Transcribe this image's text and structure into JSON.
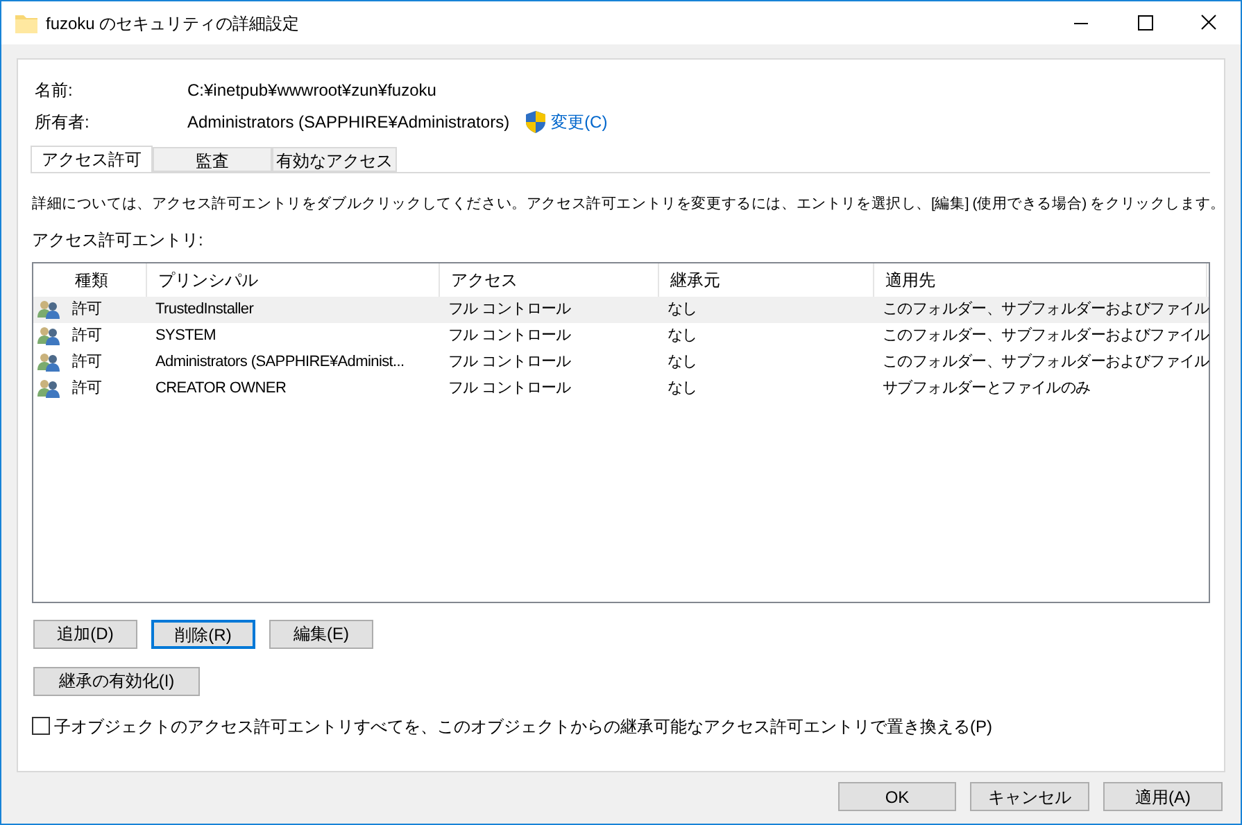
{
  "window": {
    "title": "fuzoku のセキュリティの詳細設定"
  },
  "fields": [
    {
      "label": "名前:",
      "value": "C:¥inetpub¥wwwroot¥zun¥fuzoku"
    },
    {
      "label": "所有者:",
      "value": "Administrators (SAPPHIRE¥Administrators)",
      "link": "変更(C)"
    }
  ],
  "tabs": [
    {
      "label": "アクセス許可",
      "selected": true
    },
    {
      "label": "監査",
      "selected": false
    },
    {
      "label": "有効なアクセス",
      "selected": false
    }
  ],
  "description": "詳細については、アクセス許可エントリをダブルクリックしてください。アクセス許可エントリを変更するには、エントリを選択し、[編集] (使用できる場合) をクリックします。",
  "entries_label": "アクセス許可エントリ:",
  "table": {
    "columns": [
      "種類",
      "プリンシパル",
      "アクセス",
      "継承元",
      "適用先"
    ],
    "rows": [
      {
        "type": "許可",
        "principal": "TrustedInstaller",
        "access": "フル コントロール",
        "inherited_from": "なし",
        "applies_to": "このフォルダー、サブフォルダーおよびファイル",
        "selected": true
      },
      {
        "type": "許可",
        "principal": "SYSTEM",
        "access": "フル コントロール",
        "inherited_from": "なし",
        "applies_to": "このフォルダー、サブフォルダーおよびファイル",
        "selected": false
      },
      {
        "type": "許可",
        "principal": "Administrators (SAPPHIRE¥Administ...",
        "access": "フル コントロール",
        "inherited_from": "なし",
        "applies_to": "このフォルダー、サブフォルダーおよびファイル",
        "selected": false
      },
      {
        "type": "許可",
        "principal": "CREATOR OWNER",
        "access": "フル コントロール",
        "inherited_from": "なし",
        "applies_to": "サブフォルダーとファイルのみ",
        "selected": false
      }
    ]
  },
  "entry_buttons": [
    {
      "label": "追加(D)",
      "focused": false
    },
    {
      "label": "削除(R)",
      "focused": true
    },
    {
      "label": "編集(E)",
      "focused": false
    }
  ],
  "inheritance_button": "継承の有効化(I)",
  "replace_checkbox": {
    "label": "子オブジェクトのアクセス許可エントリすべてを、このオブジェクトからの継承可能なアクセス許可エントリで置き換える(P)",
    "checked": false
  },
  "dialog_buttons": [
    "OK",
    "キャンセル",
    "適用(A)"
  ]
}
